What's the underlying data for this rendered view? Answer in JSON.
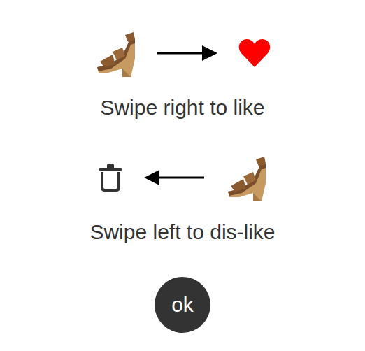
{
  "instructions": [
    {
      "kind": "like",
      "label": "Swipe right to like"
    },
    {
      "kind": "dislike",
      "label": "Swipe left to dis-like"
    }
  ],
  "button": {
    "label": "ok"
  }
}
